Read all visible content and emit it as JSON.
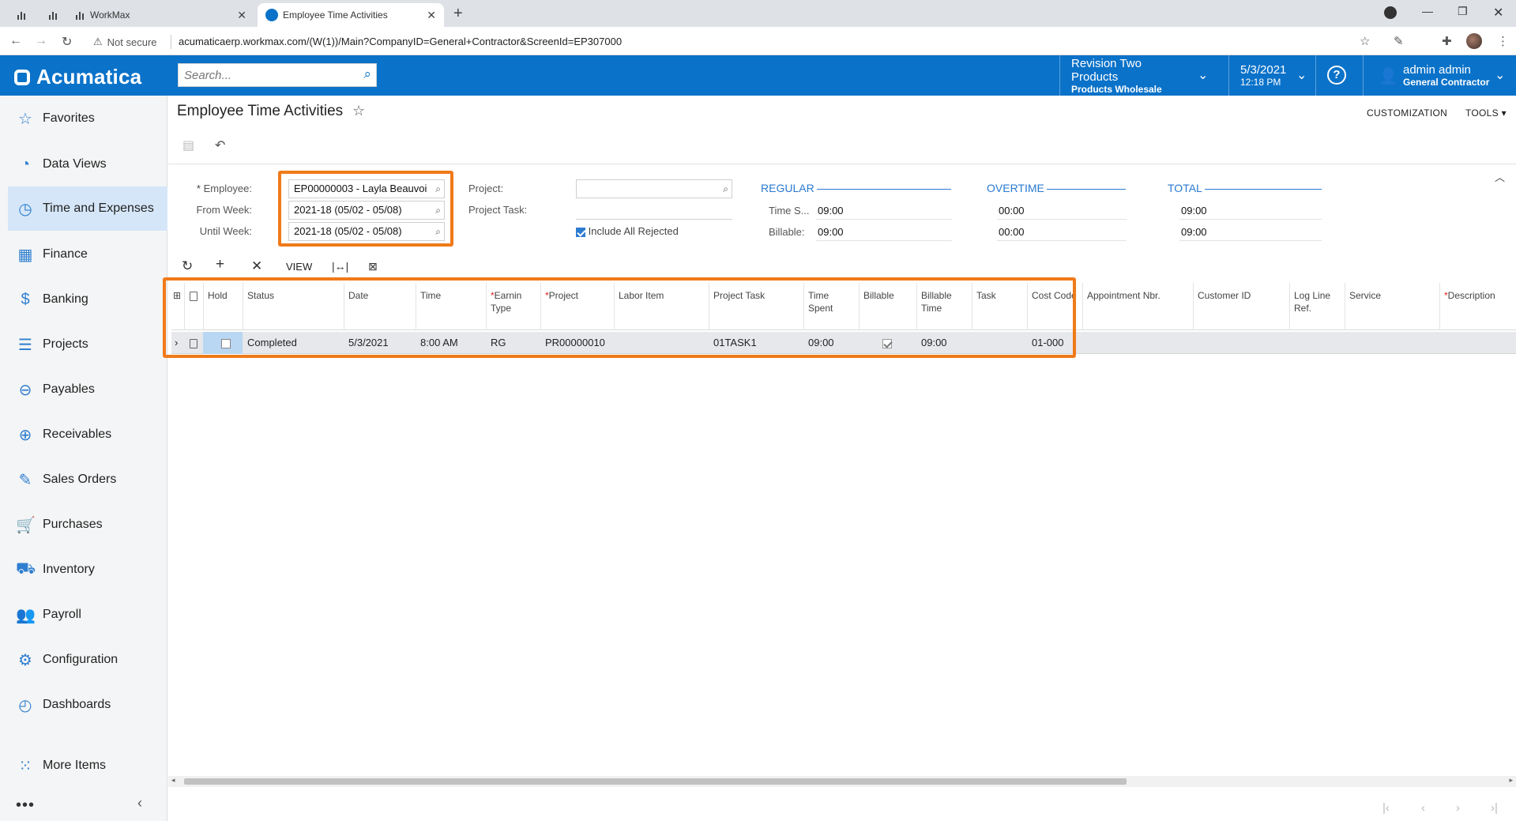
{
  "browser": {
    "tab_workmax": "WorkMax",
    "tab_active": "Employee Time Activities",
    "not_secure": "Not secure",
    "url": "acumaticaerp.workmax.com/(W(1))/Main?CompanyID=General+Contractor&ScreenId=EP307000"
  },
  "header": {
    "logo": "Acumatica",
    "search_placeholder": "Search...",
    "company_l1": "Revision Two Products",
    "company_l2": "Products Wholesale",
    "date": "5/3/2021",
    "time": "12:18 PM",
    "help": "?",
    "user_name": "admin admin",
    "user_company": "General Contractor"
  },
  "sidebar": {
    "items": [
      {
        "label": "Favorites",
        "icon": "star-icon"
      },
      {
        "label": "Data Views",
        "icon": "pie-chart-icon"
      },
      {
        "label": "Time and Expenses",
        "icon": "stopwatch-icon"
      },
      {
        "label": "Finance",
        "icon": "calculator-icon"
      },
      {
        "label": "Banking",
        "icon": "dollar-icon"
      },
      {
        "label": "Projects",
        "icon": "projects-icon"
      },
      {
        "label": "Payables",
        "icon": "minus-circle-icon"
      },
      {
        "label": "Receivables",
        "icon": "plus-circle-icon"
      },
      {
        "label": "Sales Orders",
        "icon": "pencil-icon"
      },
      {
        "label": "Purchases",
        "icon": "cart-icon"
      },
      {
        "label": "Inventory",
        "icon": "truck-icon"
      },
      {
        "label": "Payroll",
        "icon": "people-icon"
      },
      {
        "label": "Configuration",
        "icon": "gear-icon"
      },
      {
        "label": "Dashboards",
        "icon": "gauge-icon"
      }
    ],
    "more": "More Items",
    "dots": "•••",
    "collapse": "‹"
  },
  "page": {
    "title": "Employee Time Activities",
    "customization": "CUSTOMIZATION",
    "tools": "TOOLS"
  },
  "form": {
    "employee_label": "Employee:",
    "employee_value": "EP00000003 - Layla Beauvoi",
    "from_label": "From Week:",
    "from_value": "2021-18 (05/02 - 05/08)",
    "until_label": "Until Week:",
    "until_value": "2021-18 (05/02 - 05/08)",
    "project_label": "Project:",
    "project_value": "",
    "task_label": "Project Task:",
    "include_rejected": "Include All Rejected",
    "regular": "REGULAR",
    "overtime": "OVERTIME",
    "total": "TOTAL",
    "time_spent_label": "Time S...",
    "billable_label": "Billable:",
    "reg_time": "09:00",
    "reg_bill": "09:00",
    "ot_time": "00:00",
    "ot_bill": "00:00",
    "tot_time": "09:00",
    "tot_bill": "09:00"
  },
  "grid_toolbar": {
    "view": "VIEW"
  },
  "grid": {
    "columns": [
      {
        "label": "Hold",
        "required": false
      },
      {
        "label": "Status",
        "required": false
      },
      {
        "label": "Date",
        "required": false
      },
      {
        "label": "Time",
        "required": false
      },
      {
        "label": "Earnin Type",
        "required": true
      },
      {
        "label": "Project",
        "required": true
      },
      {
        "label": "Labor Item",
        "required": false
      },
      {
        "label": "Project Task",
        "required": false
      },
      {
        "label": "Time Spent",
        "required": false
      },
      {
        "label": "Billable",
        "required": false
      },
      {
        "label": "Billable Time",
        "required": false
      },
      {
        "label": "Task",
        "required": false
      },
      {
        "label": "Cost Code",
        "required": false
      },
      {
        "label": "Appointment Nbr.",
        "required": false
      },
      {
        "label": "Customer ID",
        "required": false
      },
      {
        "label": "Log Line Ref.",
        "required": false
      },
      {
        "label": "Service",
        "required": false
      },
      {
        "label": "Description",
        "required": true
      }
    ],
    "rows": [
      {
        "hold": false,
        "status": "Completed",
        "date": "5/3/2021",
        "time": "8:00 AM",
        "earning_type": "RG",
        "project": "PR00000010",
        "labor_item": "",
        "project_task": "01TASK1",
        "time_spent": "09:00",
        "billable": true,
        "billable_time": "09:00",
        "task": "",
        "cost_code": "01-000"
      }
    ]
  },
  "colors": {
    "brand": "#0a72c9",
    "highlight": "#f07a19",
    "selected_cell": "#b9d6f2"
  }
}
